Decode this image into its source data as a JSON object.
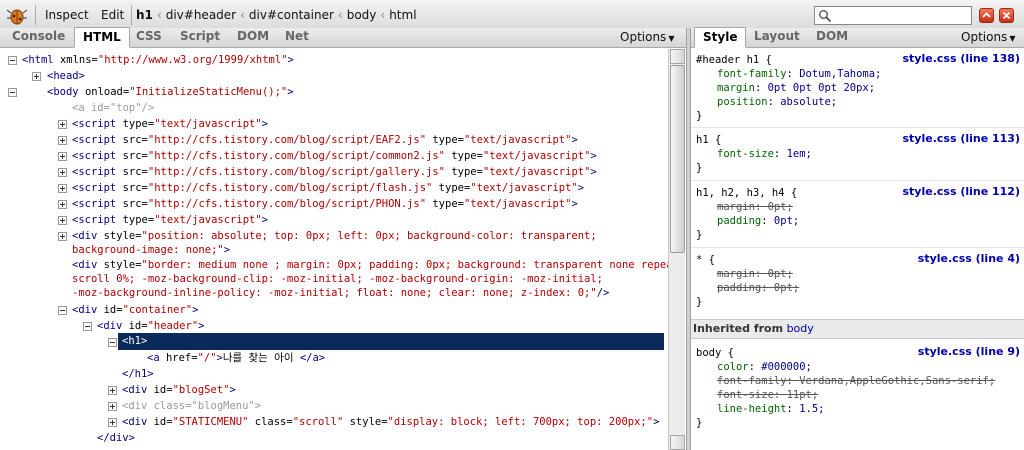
{
  "toolbar": {
    "inspect_label": "Inspect",
    "edit_label": "Edit",
    "breadcrumbs": [
      "h1",
      "div#header",
      "div#container",
      "body",
      "html"
    ],
    "search_placeholder": ""
  },
  "left_tabs": [
    "Console",
    "HTML",
    "CSS",
    "Script",
    "DOM",
    "Net"
  ],
  "left_active_tab": "HTML",
  "right_tabs": [
    "Style",
    "Layout",
    "DOM"
  ],
  "right_active_tab": "Style",
  "options_label": "Options",
  "html_tree": [
    {
      "tw": "minus",
      "text": [
        [
          "tag",
          "<html "
        ],
        [
          "attr",
          "xmlns="
        ],
        [
          "val",
          "\"http://www.w3.org/1999/xhtml\""
        ],
        [
          "tag",
          ">"
        ]
      ]
    },
    {
      "tw": "plus",
      "text": [
        [
          "tag",
          "<head>"
        ]
      ]
    },
    {
      "tw": "minus",
      "text": [
        [
          "tag",
          "<body "
        ],
        [
          "attr",
          "onload="
        ],
        [
          "val",
          "\"InitializeStaticMenu();\""
        ],
        [
          "tag",
          ">"
        ]
      ]
    },
    {
      "tw": "",
      "text": [
        [
          "dim",
          "<a id=\"top\"/>"
        ]
      ]
    },
    {
      "tw": "plus",
      "text": [
        [
          "tag",
          "<script "
        ],
        [
          "attr",
          "type="
        ],
        [
          "val",
          "\"text/javascript\""
        ],
        [
          "tag",
          ">"
        ]
      ]
    },
    {
      "tw": "plus",
      "text": [
        [
          "tag",
          "<script "
        ],
        [
          "attr",
          "src="
        ],
        [
          "val",
          "\"http://cfs.tistory.com/blog/script/EAF2.js\""
        ],
        [
          "attr",
          " type="
        ],
        [
          "val",
          "\"text/javascript\""
        ],
        [
          "tag",
          ">"
        ]
      ]
    },
    {
      "tw": "plus",
      "text": [
        [
          "tag",
          "<script "
        ],
        [
          "attr",
          "src="
        ],
        [
          "val",
          "\"http://cfs.tistory.com/blog/script/common2.js\""
        ],
        [
          "attr",
          " type="
        ],
        [
          "val",
          "\"text/javascript\""
        ],
        [
          "tag",
          ">"
        ]
      ]
    },
    {
      "tw": "plus",
      "text": [
        [
          "tag",
          "<script "
        ],
        [
          "attr",
          "src="
        ],
        [
          "val",
          "\"http://cfs.tistory.com/blog/script/gallery.js\""
        ],
        [
          "attr",
          " type="
        ],
        [
          "val",
          "\"text/javascript\""
        ],
        [
          "tag",
          ">"
        ]
      ]
    },
    {
      "tw": "plus",
      "text": [
        [
          "tag",
          "<script "
        ],
        [
          "attr",
          "src="
        ],
        [
          "val",
          "\"http://cfs.tistory.com/blog/script/flash.js\""
        ],
        [
          "attr",
          " type="
        ],
        [
          "val",
          "\"text/javascript\""
        ],
        [
          "tag",
          ">"
        ]
      ]
    },
    {
      "tw": "plus",
      "text": [
        [
          "tag",
          "<script "
        ],
        [
          "attr",
          "src="
        ],
        [
          "val",
          "\"http://cfs.tistory.com/blog/script/PHON.js\""
        ],
        [
          "attr",
          " type="
        ],
        [
          "val",
          "\"text/javascript\""
        ],
        [
          "tag",
          ">"
        ]
      ]
    },
    {
      "tw": "plus",
      "text": [
        [
          "tag",
          "<script "
        ],
        [
          "attr",
          "type="
        ],
        [
          "val",
          "\"text/javascript\""
        ],
        [
          "tag",
          ">"
        ]
      ]
    },
    {
      "tw": "plus",
      "text": [
        [
          "tag",
          "<div "
        ],
        [
          "attr",
          "style="
        ],
        [
          "val",
          "\"position: absolute; top: 0px; left: 0px; background-color: transparent;"
        ]
      ]
    },
    {
      "tw": "",
      "text": [
        [
          "val",
          "background-image: none;\""
        ],
        [
          "tag",
          ">"
        ]
      ]
    },
    {
      "tw": "",
      "text": [
        [
          "tag",
          "<div "
        ],
        [
          "attr",
          "style="
        ],
        [
          "val",
          "\"border: medium none ; margin: 0px; padding: 0px; background: transparent none repeat"
        ]
      ]
    },
    {
      "tw": "",
      "text": [
        [
          "val",
          "scroll 0%; -moz-background-clip: -moz-initial; -moz-background-origin: -moz-initial;"
        ]
      ]
    },
    {
      "tw": "",
      "text": [
        [
          "val",
          "-moz-background-inline-policy: -moz-initial; float: none; clear: none; z-index: 0;\""
        ],
        [
          "tag",
          "/>"
        ]
      ]
    },
    {
      "tw": "minus",
      "text": [
        [
          "tag",
          "<div "
        ],
        [
          "attr",
          "id="
        ],
        [
          "val",
          "\"container\""
        ],
        [
          "tag",
          ">"
        ]
      ]
    },
    {
      "tw": "minus",
      "text": [
        [
          "tag",
          "<div "
        ],
        [
          "attr",
          "id="
        ],
        [
          "val",
          "\"header\""
        ],
        [
          "tag",
          ">"
        ]
      ]
    },
    {
      "tw": "minus",
      "text": [
        [
          "tag",
          "<h1>"
        ]
      ]
    },
    {
      "tw": "",
      "text": [
        [
          "tag",
          "<a "
        ],
        [
          "attr",
          "href="
        ],
        [
          "val",
          "\"/\""
        ],
        [
          "tag",
          ">"
        ],
        [
          "txt",
          "나를 찾는 아이 "
        ],
        [
          "tag",
          "</a>"
        ]
      ]
    },
    {
      "tw": "",
      "text": [
        [
          "tag",
          "</h1>"
        ]
      ]
    },
    {
      "tw": "plus",
      "text": [
        [
          "tag",
          "<div "
        ],
        [
          "attr",
          "id="
        ],
        [
          "val",
          "\"blogSet\""
        ],
        [
          "tag",
          ">"
        ]
      ]
    },
    {
      "tw": "plus",
      "text": [
        [
          "dim",
          "<div class=\"blogMenu\">"
        ]
      ]
    },
    {
      "tw": "plus",
      "text": [
        [
          "tag",
          "<div "
        ],
        [
          "attr",
          "id="
        ],
        [
          "val",
          "\"STATICMENU\""
        ],
        [
          "attr",
          " class="
        ],
        [
          "val",
          "\"scroll\""
        ],
        [
          "attr",
          " style="
        ],
        [
          "val",
          "\"display: block; left: 700px; top: 200px;\""
        ],
        [
          "tag",
          ">"
        ]
      ]
    },
    {
      "tw": "",
      "text": [
        [
          "tag",
          "</div>"
        ]
      ]
    }
  ],
  "style_rules": [
    {
      "selector": "#header h1 {",
      "source": "style.css (line 138)",
      "props": [
        {
          "name": "font-family",
          "value": "Dotum,Tahoma;",
          "overridden": false
        },
        {
          "name": "margin",
          "value": "0pt 0pt 0pt 20px;",
          "overridden": false
        },
        {
          "name": "position",
          "value": "absolute;",
          "overridden": false
        }
      ]
    },
    {
      "selector": "h1 {",
      "source": "style.css (line 113)",
      "props": [
        {
          "name": "font-size",
          "value": "1em;",
          "overridden": false
        }
      ]
    },
    {
      "selector": "h1, h2, h3, h4 {",
      "source": "style.css (line 112)",
      "props": [
        {
          "name": "margin",
          "value": "0pt;",
          "overridden": true
        },
        {
          "name": "padding",
          "value": "0pt;",
          "overridden": false
        }
      ]
    },
    {
      "selector": "* {",
      "source": "style.css (line 4)",
      "props": [
        {
          "name": "margin",
          "value": "0pt;",
          "overridden": true
        },
        {
          "name": "padding",
          "value": "0pt;",
          "overridden": true
        }
      ]
    }
  ],
  "inherited_label": "Inherited from",
  "inherited_from": "body",
  "inherited_rule": {
    "selector": "body {",
    "source": "style.css (line 9)",
    "props": [
      {
        "name": "color",
        "value": "#000000;",
        "overridden": false
      },
      {
        "name": "font-family",
        "value": "Verdana,AppleGothic,Sans-serif;",
        "overridden": true
      },
      {
        "name": "font-size",
        "value": "11pt;",
        "overridden": true
      },
      {
        "name": "line-height",
        "value": "1.5;",
        "overridden": false
      }
    ]
  },
  "closing_brace": "}",
  "colors": {
    "selection": "#0b2a5c",
    "link": "#0000aa"
  }
}
